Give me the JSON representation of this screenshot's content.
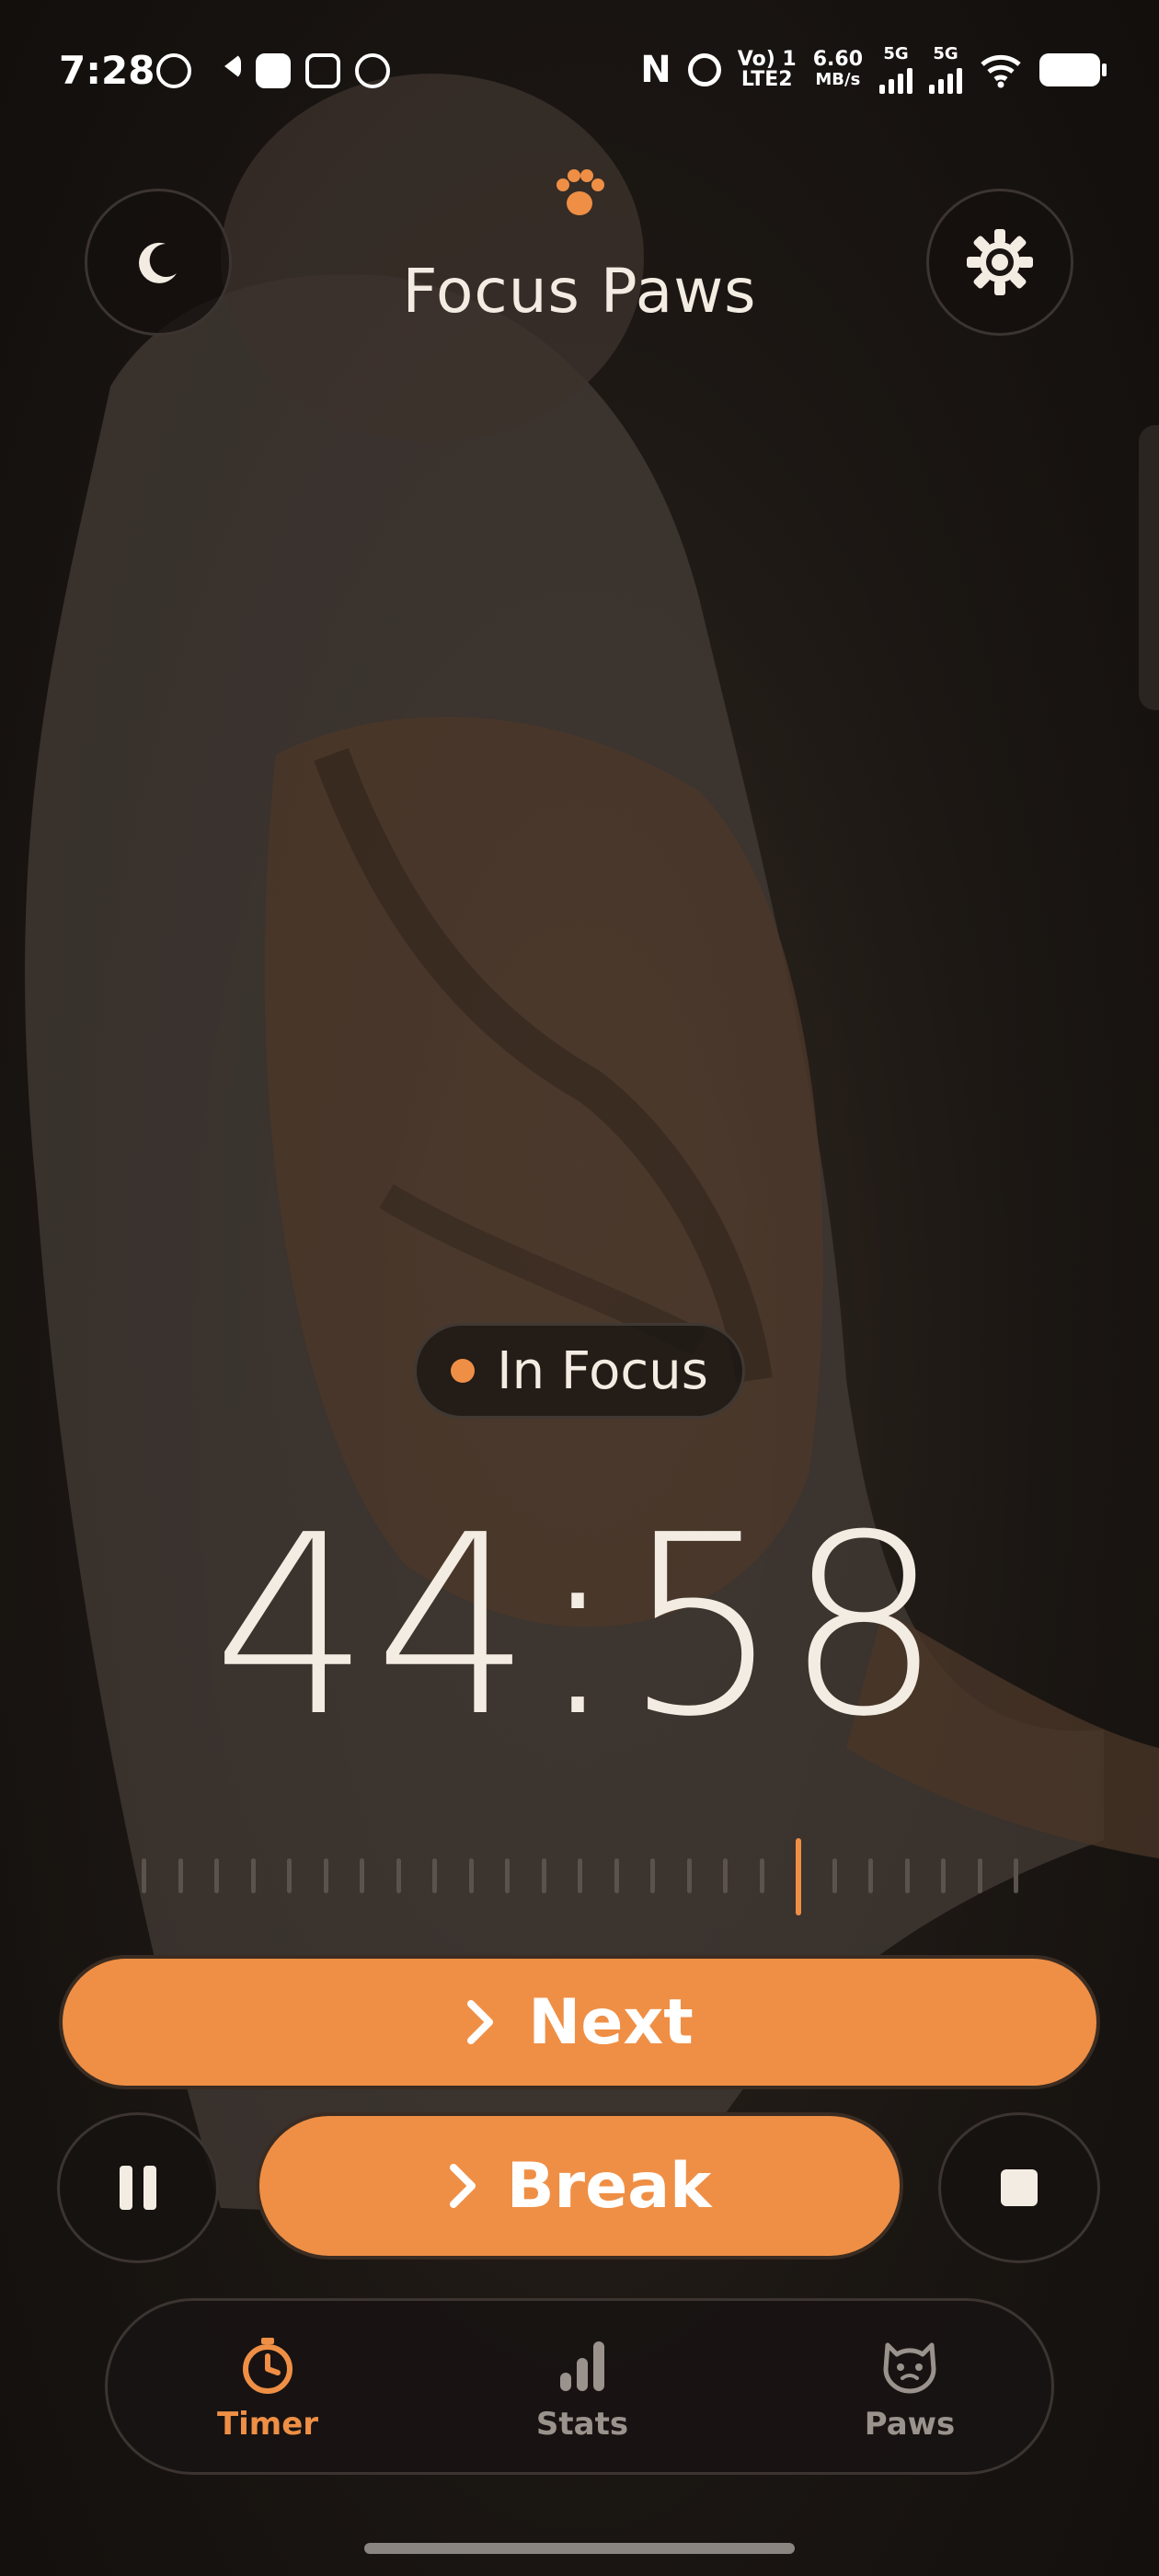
{
  "status_bar": {
    "time": "7:28",
    "network_speed_value": "6.60",
    "network_speed_unit": "MB/s",
    "carrier_label_top": "Vo) 1",
    "carrier_label_bottom": "LTE2",
    "signal_1_label": "5G",
    "signal_2_label": "5G"
  },
  "header": {
    "title": "Focus Paws",
    "left_icon": "moon-icon",
    "right_icon": "gear-icon",
    "logo_icon": "paw-icon"
  },
  "session": {
    "status_label": "In Focus",
    "time_remaining": "44:58"
  },
  "actions": {
    "next_label": "Next",
    "break_label": "Break"
  },
  "bottom_nav": {
    "items": [
      {
        "label": "Timer",
        "icon": "stopwatch-icon",
        "active": true
      },
      {
        "label": "Stats",
        "icon": "bar-chart-icon",
        "active": false
      },
      {
        "label": "Paws",
        "icon": "cat-face-icon",
        "active": false
      }
    ]
  },
  "colors": {
    "accent": "#ef8f45",
    "background": "#15110e",
    "text": "#f3ece2",
    "muted": "#9a928c"
  }
}
